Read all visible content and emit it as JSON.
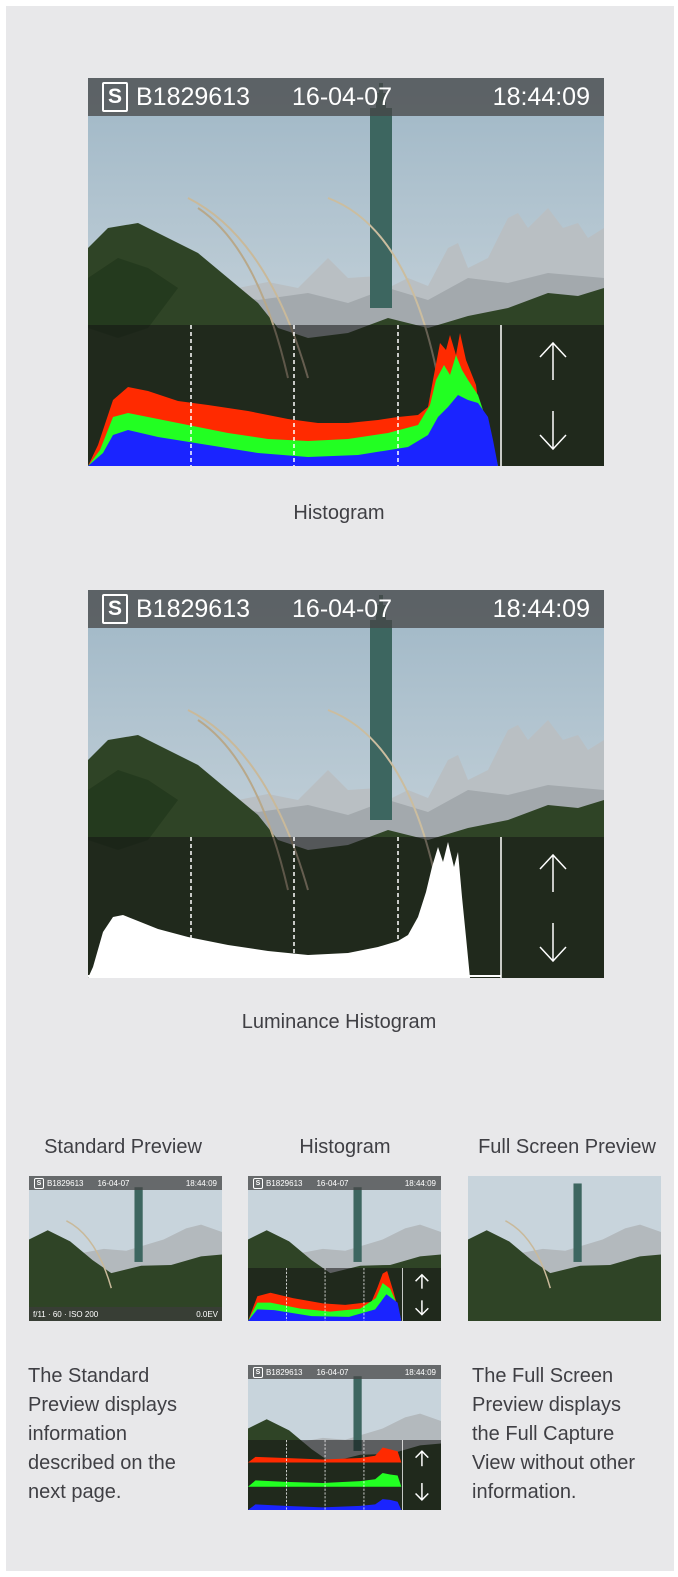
{
  "camera_header": {
    "mode_badge": "S",
    "image_id": "B1829613",
    "date": "16-04-07",
    "time": "18:44:09"
  },
  "section1": {
    "caption": "Histogram"
  },
  "section2": {
    "caption": "Luminance Histogram"
  },
  "thumbnails": {
    "standard": {
      "title": "Standard Preview",
      "exposure_info": "f/11 · 60 · ISO 200",
      "ev_value": "0.0EV",
      "description_lines": [
        "The Standard",
        "Preview displays",
        "information",
        "described on the",
        "next page."
      ]
    },
    "histogram": {
      "title": "Histogram"
    },
    "fullscreen": {
      "title": "Full Screen Preview",
      "description_lines": [
        "The Full Screen",
        "Preview displays",
        "the Full Capture",
        "View without other",
        "information."
      ]
    }
  },
  "icons": [
    "up-arrow-icon",
    "down-arrow-icon",
    "mode-s-badge-icon"
  ],
  "colors": {
    "panel": "#e8e8ea",
    "red": "#ff2a00",
    "green": "#22ff22",
    "blue": "#1a24ff",
    "luminance": "#ffffff"
  }
}
